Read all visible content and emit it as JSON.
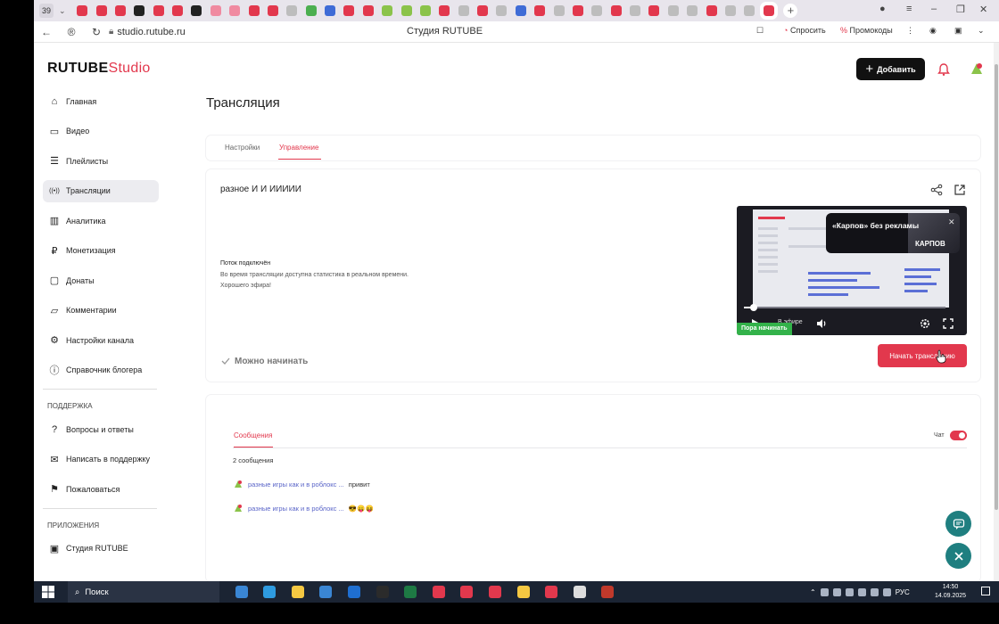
{
  "browser": {
    "tab_count": "39",
    "url": "studio.rutube.ru",
    "page_title": "Студия RUTUBE",
    "ask_label": "Спросить",
    "promo_label": "Промокоды",
    "tab_colors": [
      "#e2384d",
      "#e2384d",
      "#e2384d",
      "#222222",
      "#e2384d",
      "#e2384d",
      "#222222",
      "#f08aa0",
      "#f08aa0",
      "#e2384d",
      "#e2384d",
      "#bdbdbd",
      "#4caf50",
      "#3f6cd6",
      "#e2384d",
      "#e2384d",
      "#8bc34a",
      "#8bc34a",
      "#8bc34a",
      "#e2384d",
      "#bdbdbd",
      "#e2384d",
      "#bdbdbd",
      "#3f6cd6",
      "#e2384d",
      "#bdbdbd",
      "#e2384d",
      "#bdbdbd",
      "#e2384d",
      "#bdbdbd",
      "#e2384d",
      "#bdbdbd",
      "#bdbdbd",
      "#e2384d",
      "#bdbdbd",
      "#bdbdbd",
      "#e2384d"
    ]
  },
  "header": {
    "logo_main": "RUTUBE",
    "logo_studio": "Studio",
    "add_label": "Добавить"
  },
  "sidebar": {
    "items": [
      {
        "label": "Главная",
        "icon": "home-icon",
        "active": false
      },
      {
        "label": "Видео",
        "icon": "video-icon",
        "active": false
      },
      {
        "label": "Плейлисты",
        "icon": "playlist-icon",
        "active": false
      },
      {
        "label": "Трансляции",
        "icon": "broadcast-icon",
        "active": true
      },
      {
        "label": "Аналитика",
        "icon": "analytics-icon",
        "active": false
      },
      {
        "label": "Монетизация",
        "icon": "ruble-icon",
        "active": false
      },
      {
        "label": "Донаты",
        "icon": "donate-icon",
        "active": false
      },
      {
        "label": "Комментарии",
        "icon": "comment-icon",
        "active": false
      },
      {
        "label": "Настройки канала",
        "icon": "gear-icon",
        "active": false
      },
      {
        "label": "Справочник блогера",
        "icon": "info-icon",
        "active": false
      }
    ],
    "support_title": "ПОДДЕРЖКА",
    "support_items": [
      {
        "label": "Вопросы и ответы",
        "icon": "help-icon"
      },
      {
        "label": "Написать в поддержку",
        "icon": "mail-icon"
      },
      {
        "label": "Пожаловаться",
        "icon": "flag-icon"
      }
    ],
    "apps_title": "ПРИЛОЖЕНИЯ",
    "apps_items": [
      {
        "label": "Студия RUTUBE",
        "icon": "app-icon"
      }
    ]
  },
  "main": {
    "title": "Трансляция",
    "tabs": [
      {
        "label": "Настройки",
        "active": false
      },
      {
        "label": "Управление",
        "active": true
      }
    ],
    "stream": {
      "title": "разное И И ИИИИИ",
      "status": "Поток подключён",
      "info_line1": "Во время трансляции доступна статистика в реальном времени.",
      "info_line2": "Хорошего эфира!",
      "ready_label": "Можно начинать",
      "start_label": "Начать трансляцию",
      "player": {
        "ad_text": "«Карпов» без рекламы",
        "ad_brand": "КАРПОВ",
        "live_text": "В эфире",
        "badge": "Пора начинать"
      }
    },
    "chat": {
      "tab_label": "Сообщения",
      "toggle_label": "Чат",
      "count": "2 сообщения",
      "messages": [
        {
          "author": "разные игры как и в роблокс ...",
          "text": "привит"
        },
        {
          "author": "разные игры как и в роблокс ...",
          "text": "😎😛😝"
        }
      ]
    }
  },
  "taskbar": {
    "search_label": "Поиск",
    "lang": "РУС",
    "time": "14:50",
    "date": "14.09.2025",
    "app_colors": [
      "#3a86d4",
      "#2e9be0",
      "#f5c842",
      "#3a86d4",
      "#1f6fd1",
      "#2b2b2b",
      "#1e7a44",
      "#e2384d",
      "#e2384d",
      "#e2384d",
      "#f5c842",
      "#e2384d",
      "#dddddd",
      "#c0392b"
    ]
  }
}
